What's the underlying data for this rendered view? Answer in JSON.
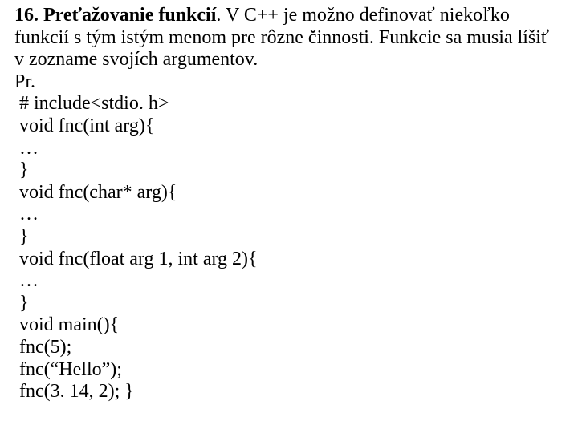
{
  "heading_number": "16. ",
  "heading_title": "Preťažovanie funkcií",
  "intro_rest": ". V C++ je možno definovať niekoľko funkcií s tým istým menom pre rôzne činnosti. Funkcie sa musia líšiť v zozname svojích argumentov.",
  "pr": "Pr.",
  "code": {
    "l1": "# include<stdio. h>",
    "l2": "void fnc(int arg){",
    "l3": "…",
    "l4": "}",
    "l5": "void fnc(char* arg){",
    "l6": "…",
    "l7": "}",
    "l8": "void fnc(float arg 1, int arg 2){",
    "l9": "…",
    "l10": "}",
    "l11": "void main(){",
    "l12": "fnc(5);",
    "l13": "fnc(“Hello”);",
    "l14": "fnc(3. 14, 2); }"
  }
}
